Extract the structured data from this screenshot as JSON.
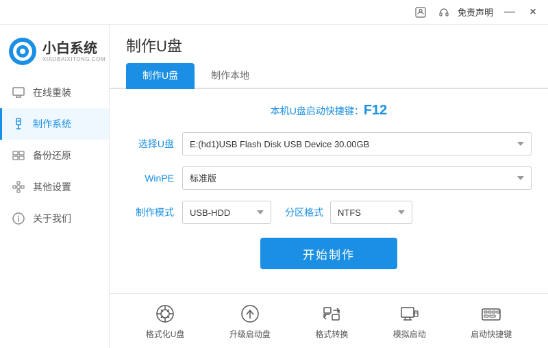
{
  "titlebar": {
    "icons": [
      "user-icon",
      "headset-icon"
    ],
    "free_label": "免责声明",
    "min_label": "—",
    "close_label": "×"
  },
  "sidebar": {
    "logo_name": "小白系统",
    "logo_sub": "XIAOBAIXITONG.COM",
    "items": [
      {
        "id": "online-reinstall",
        "label": "在线重装",
        "icon": "monitor-icon"
      },
      {
        "id": "make-system",
        "label": "制作系统",
        "icon": "usb-icon",
        "active": true
      },
      {
        "id": "backup-restore",
        "label": "备份还原",
        "icon": "backup-icon"
      },
      {
        "id": "other-settings",
        "label": "其他设置",
        "icon": "settings-icon"
      },
      {
        "id": "about-us",
        "label": "关于我们",
        "icon": "info-icon"
      }
    ]
  },
  "page": {
    "title": "制作U盘",
    "tabs": [
      {
        "label": "制作U盘",
        "active": true
      },
      {
        "label": "制作本地"
      }
    ],
    "shortcut": {
      "prefix": "本机U盘启动快捷键：",
      "key": "F12"
    },
    "form": {
      "usb_label": "选择U盘",
      "usb_value": "E:(hd1)USB Flash Disk USB Device 30.00GB",
      "winpe_label": "WinPE",
      "winpe_value": "标准版",
      "mode_label": "制作模式",
      "mode_value": "USB-HDD",
      "partition_label": "分区格式",
      "partition_value": "NTFS",
      "start_button": "开始制作"
    },
    "bottom_tools": [
      {
        "id": "format-usb",
        "label": "格式化U盘",
        "icon": "format-icon"
      },
      {
        "id": "upgrade-boot",
        "label": "升级启动盘",
        "icon": "upgrade-icon"
      },
      {
        "id": "format-convert",
        "label": "格式转换",
        "icon": "convert-icon"
      },
      {
        "id": "simulate-boot",
        "label": "模拟启动",
        "icon": "simulate-icon"
      },
      {
        "id": "boot-shortcut",
        "label": "启动快捷键",
        "icon": "keyboard-icon"
      }
    ]
  }
}
